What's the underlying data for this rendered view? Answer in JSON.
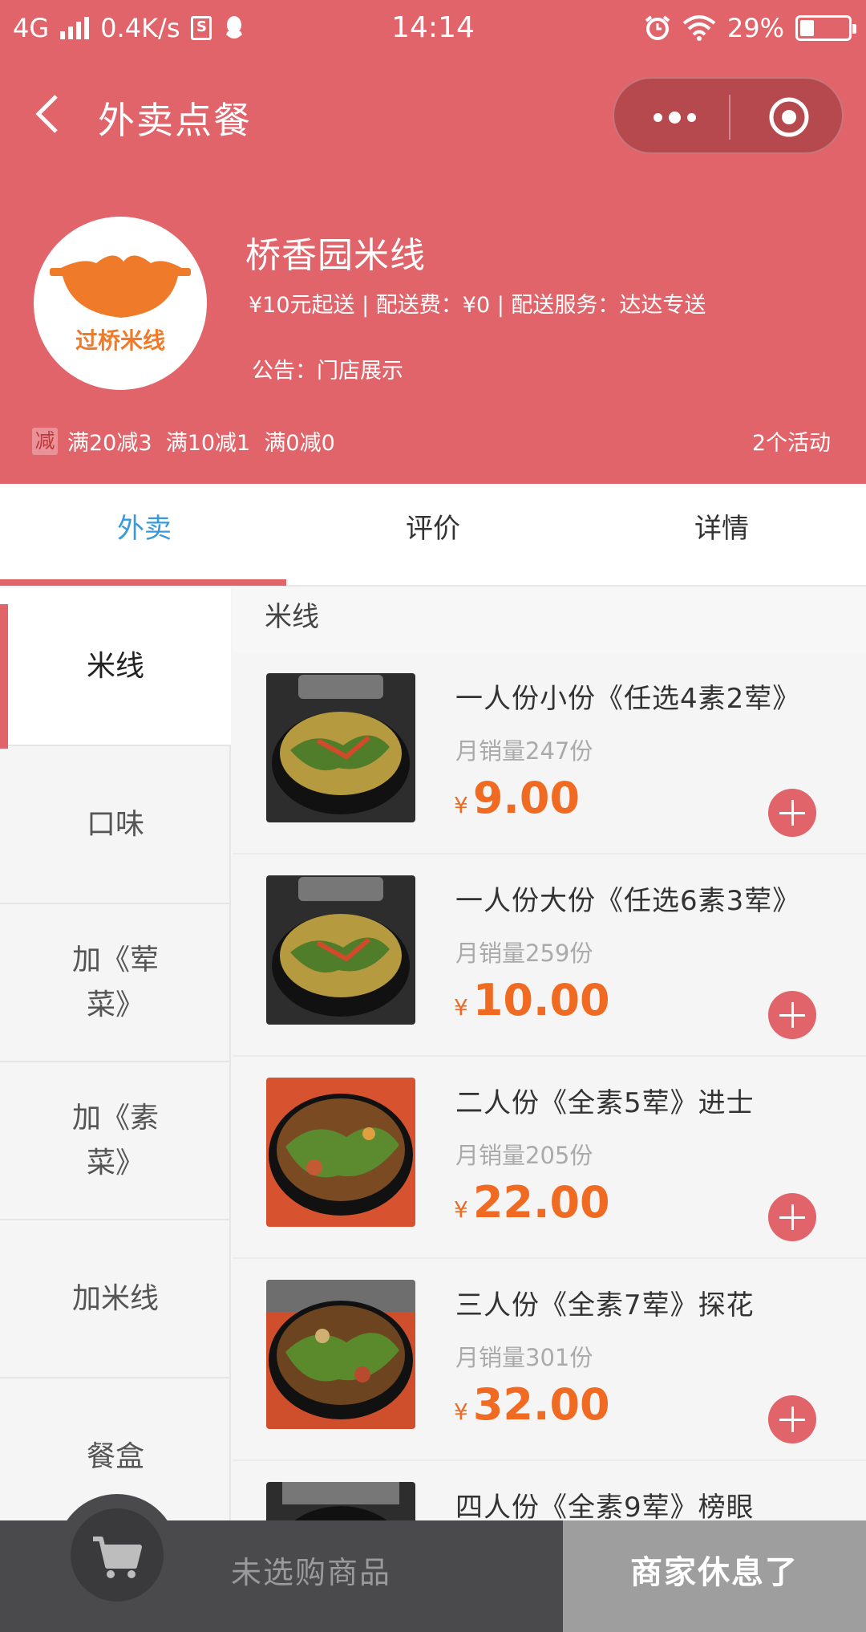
{
  "status_bar": {
    "network": "4G",
    "speed": "0.4K/s",
    "time": "14:14",
    "battery": "29%",
    "battery_level": 0.29
  },
  "nav": {
    "title": "外卖点餐",
    "back_icon": "chevron-left-icon",
    "menu_icon": "more-dots-icon",
    "close_icon": "target-circle-icon"
  },
  "shop": {
    "name": "桥香园米线",
    "info": "¥10元起送 | 配送费：¥0 | 配送服务：达达专送",
    "notice": "公告：门店展示",
    "logo_text": "过桥米线",
    "promo_badge": "减",
    "promo_text": "满20减3  满10减1  满0减0",
    "promo_count": "2个活动"
  },
  "tabs": [
    {
      "label": "外卖",
      "active": true
    },
    {
      "label": "评价",
      "active": false
    },
    {
      "label": "详情",
      "active": false
    }
  ],
  "categories": [
    {
      "label": "米线",
      "active": true
    },
    {
      "label": "口味"
    },
    {
      "label": "加《荤\n菜》"
    },
    {
      "label": "加《素\n菜》"
    },
    {
      "label": "加米线"
    },
    {
      "label": "餐盒"
    }
  ],
  "section_title": "米线",
  "products": [
    {
      "name": "一人份小份《任选4素2荤》",
      "sales": "月销量247份",
      "currency": "¥",
      "price": "9.00"
    },
    {
      "name": "一人份大份《任选6素3荤》",
      "sales": "月销量259份",
      "currency": "¥",
      "price": "10.00"
    },
    {
      "name": "二人份《全素5荤》进士",
      "sales": "月销量205份",
      "currency": "¥",
      "price": "22.00"
    },
    {
      "name": "三人份《全素7荤》探花",
      "sales": "月销量301份",
      "currency": "¥",
      "price": "32.00"
    },
    {
      "name": "四人份《全素9荤》榜眼",
      "sales": "",
      "currency": "",
      "price": ""
    }
  ],
  "cart": {
    "empty_text": "未选购商品",
    "closed_text": "商家休息了",
    "icon": "cart-icon"
  },
  "colors": {
    "brand": "#e0646a",
    "price": "#f06a22",
    "active_tab": "#3a9ad9"
  }
}
